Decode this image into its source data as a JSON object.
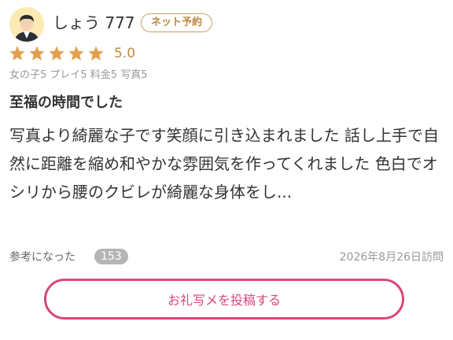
{
  "review": {
    "username": "しょう 777",
    "badge": "ネット予約",
    "rating": 5,
    "rating_label": "5.0",
    "subscores": "女の子5 プレイ5 料金5 写真5",
    "title": "至福の時間でした",
    "body": "写真より綺麗な子です笑顔に引き込まれました 話し上手で自然に距離を縮め和やかな雰囲気を作ってくれました 色白でオシリから腰のクビレが綺麗な身体をし...",
    "helpful_label": "参考になった",
    "helpful_count": "153",
    "visit_date": "2026年8月26日訪問"
  },
  "cta": {
    "label": "お礼写メを投稿する"
  },
  "colors": {
    "star": "#e3a04f",
    "accent_pink": "#d9467d",
    "badge_gold": "#b98a44"
  },
  "icons": {
    "avatar": "user-avatar-icon",
    "star": "star-icon"
  }
}
